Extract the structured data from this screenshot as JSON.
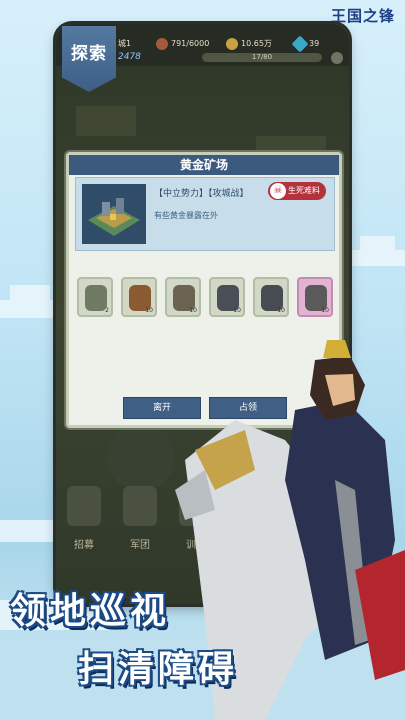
{
  "brand": "王国之锋",
  "topbar": {
    "city_label": "城1",
    "troops": "791/6000",
    "gold": "10.65万",
    "gems": "39",
    "power": "2478",
    "progress": "17/80"
  },
  "explore_tab": "探索",
  "dialog": {
    "title": "黄金矿场",
    "tags": "【中立势力】【攻城战】",
    "badge": "生死难料",
    "desc": "有些黄金暴露在外",
    "enemies": [
      {
        "name": "stone-golem",
        "count": "2",
        "color": "#6e7a62"
      },
      {
        "name": "brown-bear",
        "count": "10",
        "color": "#8a5a32"
      },
      {
        "name": "eagle",
        "count": "10",
        "color": "#6b6252"
      },
      {
        "name": "dark-wolf",
        "count": "10",
        "color": "#4a4f56"
      },
      {
        "name": "dark-wolf",
        "count": "10",
        "color": "#474b52"
      },
      {
        "name": "hooded-reaper",
        "count": "10",
        "color": "#5a5a5a"
      }
    ],
    "leave_label": "离开",
    "occupy_label": "占领"
  },
  "bottom_nav": [
    "招募",
    "军团",
    "训练"
  ],
  "slogan": {
    "line1": "领地巡视",
    "line2": "扫清障碍"
  },
  "colors": {
    "dialog_header": "#3c5a7e",
    "badge": "#b4323c",
    "slogan_outline": "#1b4a86"
  }
}
